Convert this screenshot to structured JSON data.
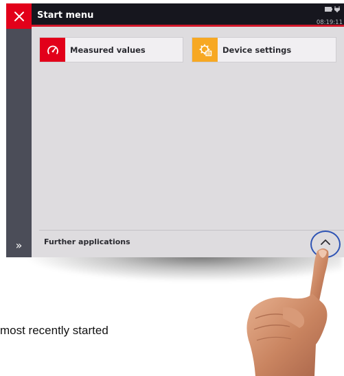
{
  "window": {
    "title": "Start menu",
    "clock": "08:19:11",
    "close_icon": "close-x-icon",
    "status_icons": [
      "battery-icon",
      "power-plug-icon"
    ]
  },
  "tiles": [
    {
      "label": "Measured values",
      "icon": "speedometer-icon",
      "color": "#e2001a"
    },
    {
      "label": "Device settings",
      "icon": "settings-gear-icon",
      "color": "#f7a823"
    }
  ],
  "footer": {
    "label": "Further applications",
    "toggle_icon": "chevron-up-icon",
    "sidebar_icon": "double-chevron-right-icon"
  },
  "caption": "most recently started",
  "colors": {
    "accent_red": "#e2001a",
    "accent_orange": "#f7a823",
    "titlebar": "#16161e",
    "sidebar": "#4b4d58",
    "screen_bg": "#dedcdf",
    "highlight_ring": "#2d53b4"
  }
}
